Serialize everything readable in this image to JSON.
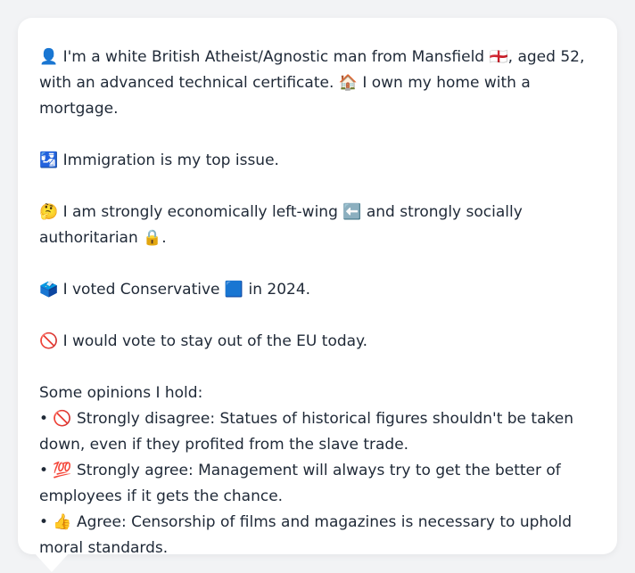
{
  "profile": {
    "intro": "👤 I'm a white British Atheist/Agnostic man from Mansfield 🏴󠁧󠁢󠁥󠁮󠁧󠁿, aged 52, with an advanced technical certificate. 🏠 I own my home with a mortgage.",
    "top_issue": "🛂 Immigration is my top issue.",
    "political_leaning": "🤔 I am strongly economically left-wing ⬅️ and strongly socially authoritarian 🔒.",
    "vote_2024": "🗳️ I voted Conservative 🟦 in 2024.",
    "eu_vote": "🚫 I would vote to stay out of the EU today.",
    "opinions_heading": "Some opinions I hold:",
    "opinions": [
      "• 🚫 Strongly disagree: Statues of historical figures shouldn't be taken down, even if they profited from the slave trade.",
      "• 💯 Strongly agree: Management will always try to get the better of employees if it gets the chance.",
      "• 👍 Agree: Censorship of films and magazines is necessary to uphold moral standards."
    ]
  }
}
